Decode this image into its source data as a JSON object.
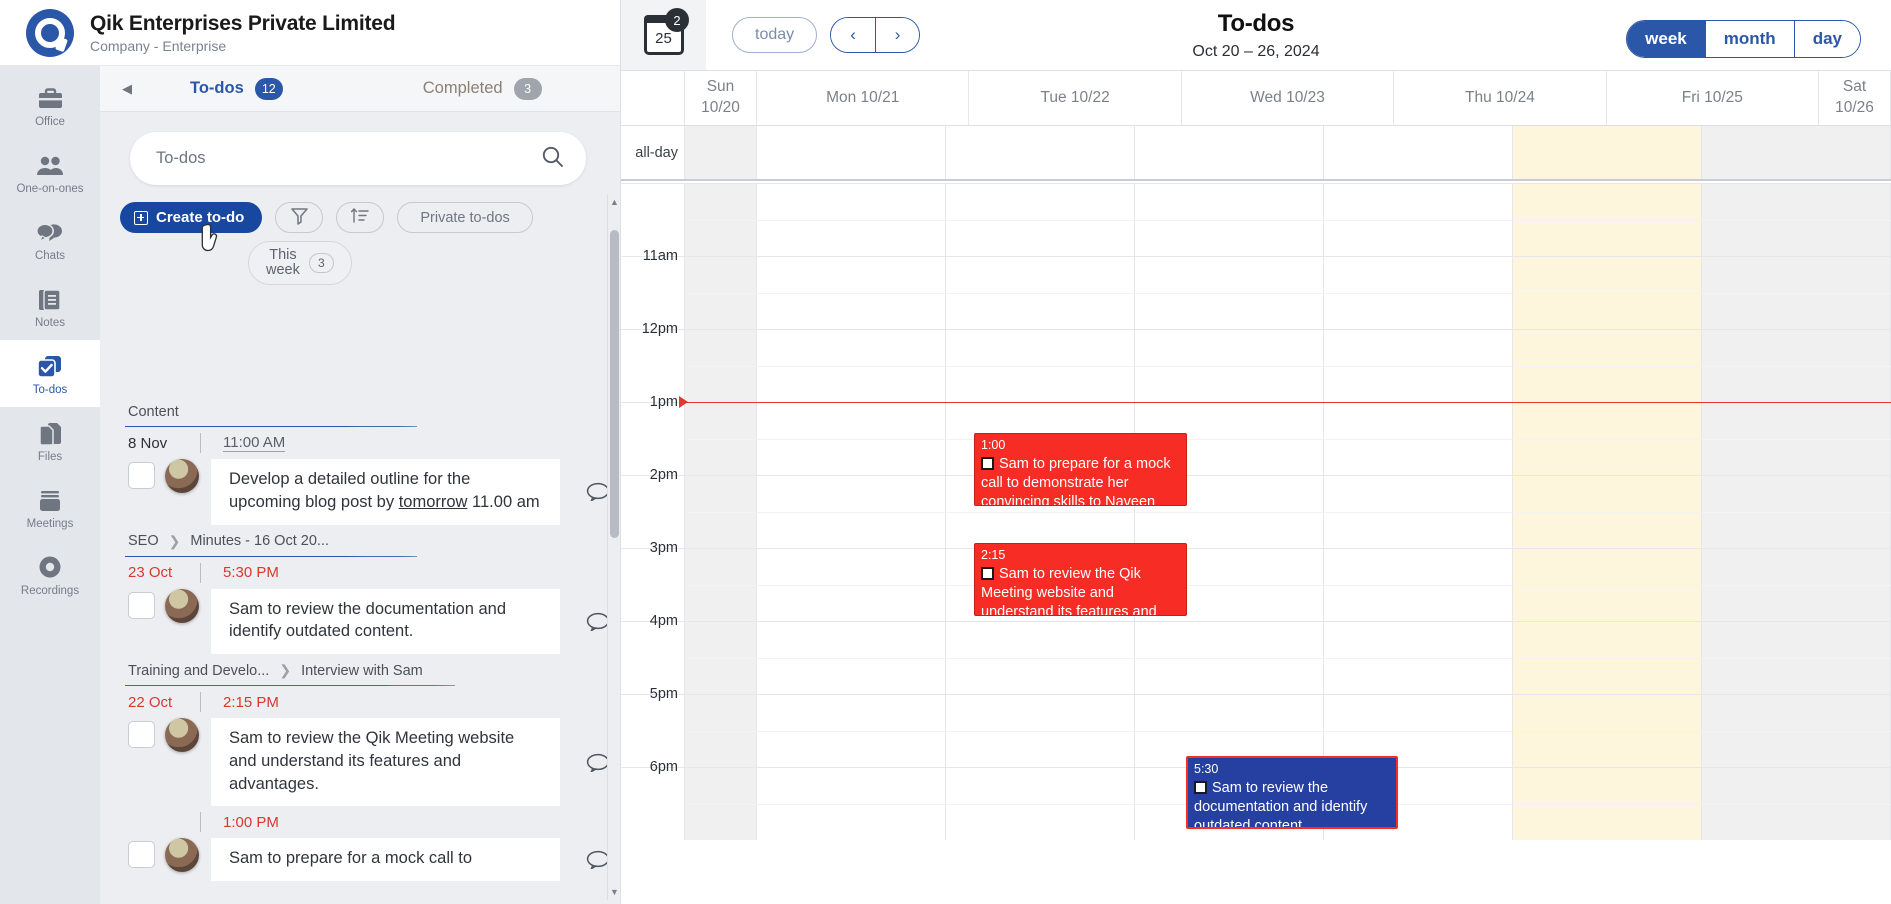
{
  "brand": {
    "title": "Qik Enterprises Private Limited",
    "subtitle": "Company - Enterprise",
    "logo_icon": "qik-logo-icon"
  },
  "rail": {
    "items": [
      {
        "label": "Office",
        "icon": "briefcase-icon",
        "active": false
      },
      {
        "label": "One-on-ones",
        "icon": "people-icon",
        "active": false
      },
      {
        "label": "Chats",
        "icon": "chat-bubbles-icon",
        "active": false
      },
      {
        "label": "Notes",
        "icon": "notes-icon",
        "active": false
      },
      {
        "label": "To-dos",
        "icon": "checkbox-stack-icon",
        "active": true
      },
      {
        "label": "Files",
        "icon": "files-icon",
        "active": false
      },
      {
        "label": "Meetings",
        "icon": "meetings-icon",
        "active": false
      },
      {
        "label": "Recordings",
        "icon": "record-icon",
        "active": false
      }
    ]
  },
  "panel": {
    "back_arrow": "◀",
    "tabs": [
      {
        "label": "To-dos",
        "count": "12"
      },
      {
        "label": "Completed",
        "count": "3"
      }
    ],
    "search": {
      "placeholder": "To-dos",
      "value": "",
      "icon": "search-icon"
    },
    "actions": {
      "create_label": "Create to-do",
      "filter_icon": "funnel-filter-icon",
      "sort_icon": "sort-ascending-icon",
      "private_label": "Private to-dos",
      "week_label_line1": "This",
      "week_label_line2": "week",
      "week_count": "3"
    },
    "groups": [
      {
        "breadcrumb": [
          "Content"
        ],
        "accent": "blue",
        "rows": [
          {
            "date": "8 Nov",
            "date_red": false,
            "time": "11:00 AM",
            "time_red": false,
            "time_underline": true,
            "text_before": "Develop a detailed outline for the upcoming blog post by ",
            "text_link": "tomorrow",
            "text_after": " 11.00 am",
            "comment_icon": "comment-bubble-icon"
          }
        ]
      },
      {
        "breadcrumb": [
          "SEO",
          "Minutes - 16 Oct 20..."
        ],
        "accent": "blue",
        "rows": [
          {
            "date": "23 Oct",
            "date_red": true,
            "time": "5:30 PM",
            "time_red": true,
            "time_underline": false,
            "text_before": "Sam to review the documentation and identify outdated content.",
            "text_link": "",
            "text_after": "",
            "comment_icon": "comment-bubble-icon"
          }
        ]
      },
      {
        "breadcrumb": [
          "Training and Develo...",
          "Interview with Sam"
        ],
        "accent": "red",
        "rows": [
          {
            "date": "22 Oct",
            "date_red": true,
            "time": "2:15 PM",
            "time_red": true,
            "time_underline": false,
            "text_before": "Sam to review the Qik Meeting website and understand its features and advantages.",
            "text_link": "",
            "text_after": "",
            "comment_icon": "comment-bubble-icon"
          },
          {
            "date": "",
            "date_red": true,
            "time": "1:00 PM",
            "time_red": true,
            "time_underline": false,
            "text_before": "Sam to prepare for a mock call to",
            "text_link": "",
            "text_after": "",
            "comment_icon": "comment-bubble-icon"
          }
        ]
      }
    ]
  },
  "calendar": {
    "mini_cal_day": "25",
    "mini_cal_badge": "2",
    "today_label": "today",
    "prev_icon": "chevron-left-icon",
    "next_icon": "chevron-right-icon",
    "title": "To-dos",
    "range": "Oct 20 – 26, 2024",
    "views": [
      {
        "label": "week",
        "active": true
      },
      {
        "label": "month",
        "active": false
      },
      {
        "label": "day",
        "active": false
      }
    ],
    "allday_label": "all-day",
    "days": [
      {
        "label": "Sun 10/20",
        "line1": "Sun",
        "line2": "10/20",
        "two_line": true,
        "highlight": false,
        "weekend": true
      },
      {
        "label": "Mon 10/21",
        "line1": "Mon 10/21",
        "line2": "",
        "two_line": false,
        "highlight": false,
        "weekend": false
      },
      {
        "label": "Tue 10/22",
        "line1": "Tue 10/22",
        "line2": "",
        "two_line": false,
        "highlight": false,
        "weekend": false
      },
      {
        "label": "Wed 10/23",
        "line1": "Wed 10/23",
        "line2": "",
        "two_line": false,
        "highlight": false,
        "weekend": false
      },
      {
        "label": "Thu 10/24",
        "line1": "Thu 10/24",
        "line2": "",
        "two_line": false,
        "highlight": false,
        "weekend": false
      },
      {
        "label": "Fri 10/25",
        "line1": "Fri 10/25",
        "line2": "",
        "two_line": false,
        "highlight": true,
        "weekend": false
      },
      {
        "label": "Sat 10/26",
        "line1": "Sat",
        "line2": "10/26",
        "two_line": true,
        "highlight": false,
        "weekend": true
      }
    ],
    "time_slots": [
      "",
      "11am",
      "12pm",
      "1pm",
      "2pm",
      "3pm",
      "4pm",
      "5pm",
      "6pm"
    ],
    "now_indicator_time": "12:40pm",
    "events": [
      {
        "time": "1:00",
        "title": "Sam to prepare for a mock call to demonstrate her convincing skills to Naveen",
        "color": "red",
        "day": "Tue 10/22",
        "checkbox_icon": "checkbox-icon"
      },
      {
        "time": "2:15",
        "title": "Sam to review the Qik Meeting website and understand its features and",
        "color": "red",
        "day": "Tue 10/22",
        "checkbox_icon": "checkbox-icon"
      },
      {
        "time": "5:30",
        "title": "Sam to review the documentation and identify outdated content.",
        "color": "blue",
        "day": "Wed 10/23",
        "checkbox_icon": "checkbox-icon"
      }
    ]
  },
  "colors": {
    "brand_blue": "#2b57a8",
    "create_blue": "#17479e",
    "event_red": "#f72c24",
    "event_blue": "#2540a0",
    "overdue_red": "#d8392f",
    "highlight_yellow": "#fdf6dd"
  }
}
